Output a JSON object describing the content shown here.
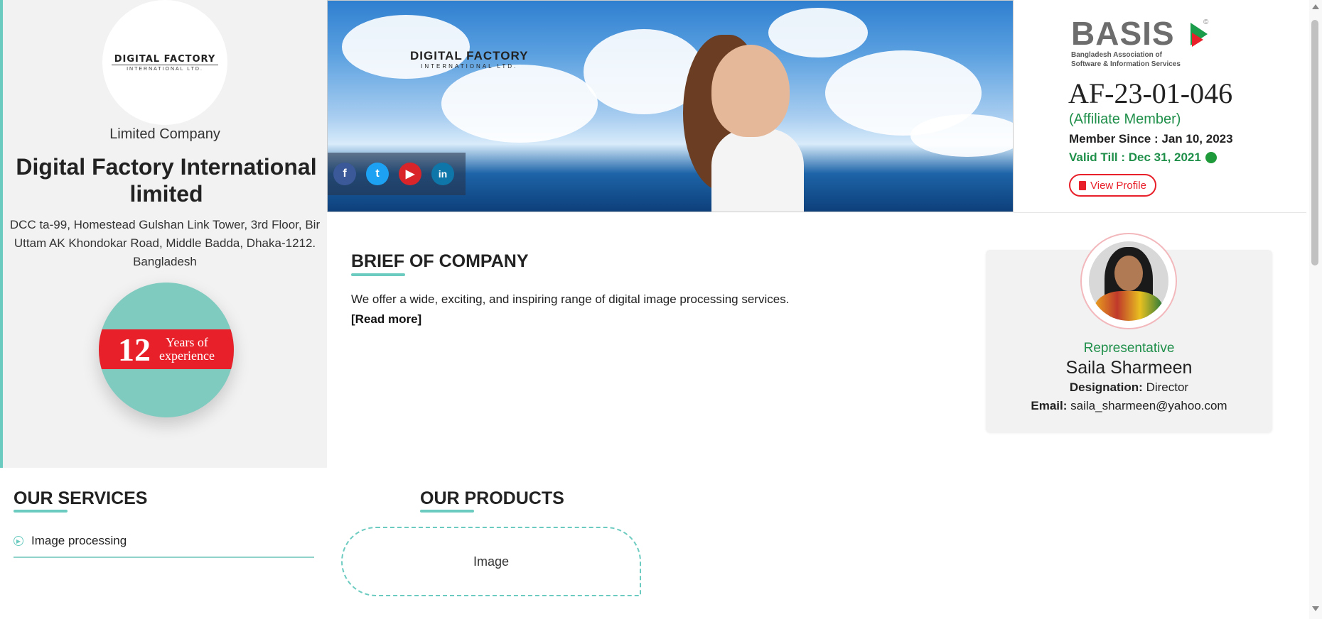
{
  "company": {
    "logo_line1": "DIGITAL FACTORY",
    "logo_line2": "INTERNATIONAL LTD.",
    "type": "Limited Company",
    "name": "Digital Factory International limited",
    "address": "DCC ta-99, Homestead Gulshan Link Tower, 3rd Floor, Bir Uttam AK Khondokar Road, Middle Badda, Dhaka-1212. Bangladesh",
    "experience_years": "12",
    "experience_label_1": "Years of",
    "experience_label_2": "experience"
  },
  "banner": {
    "logo_line1": "DIGITAL FACTORY",
    "logo_line2": "INTERNATIONAL LTD.",
    "social": [
      {
        "name": "facebook",
        "glyph": "f"
      },
      {
        "name": "twitter",
        "glyph": "t"
      },
      {
        "name": "youtube",
        "glyph": "▶"
      },
      {
        "name": "linkedin",
        "glyph": "in"
      }
    ]
  },
  "membership": {
    "org_logo_word": "BASIS",
    "org_logo_copyright": "©",
    "org_sub_1": "Bangladesh Association of",
    "org_sub_2": "Software & Information Services",
    "member_id": "AF-23-01-046",
    "member_type": "(Affiliate Member)",
    "member_since": "Member Since : Jan 10, 2023",
    "valid_till": "Valid Till : Dec 31, 2021",
    "view_profile_label": "View Profile",
    "status_color": "#1f9a3a"
  },
  "brief": {
    "title": "BRIEF OF COMPANY",
    "text": "We offer a wide, exciting, and inspiring range of digital image processing services.",
    "read_more": "[Read more]"
  },
  "representative": {
    "role": "Representative",
    "name": "Saila Sharmeen",
    "designation_label": "Designation:",
    "designation_value": "Director",
    "email_label": "Email:",
    "email_value": "saila_sharmeen@yahoo.com"
  },
  "services": {
    "title": "OUR SERVICES",
    "items": [
      "Image processing"
    ]
  },
  "products": {
    "title": "OUR PRODUCTS",
    "items": [
      "Image"
    ]
  },
  "colors": {
    "accent": "#6ccbc0",
    "brand_red": "#e8202a",
    "member_green": "#1f8f4a"
  }
}
